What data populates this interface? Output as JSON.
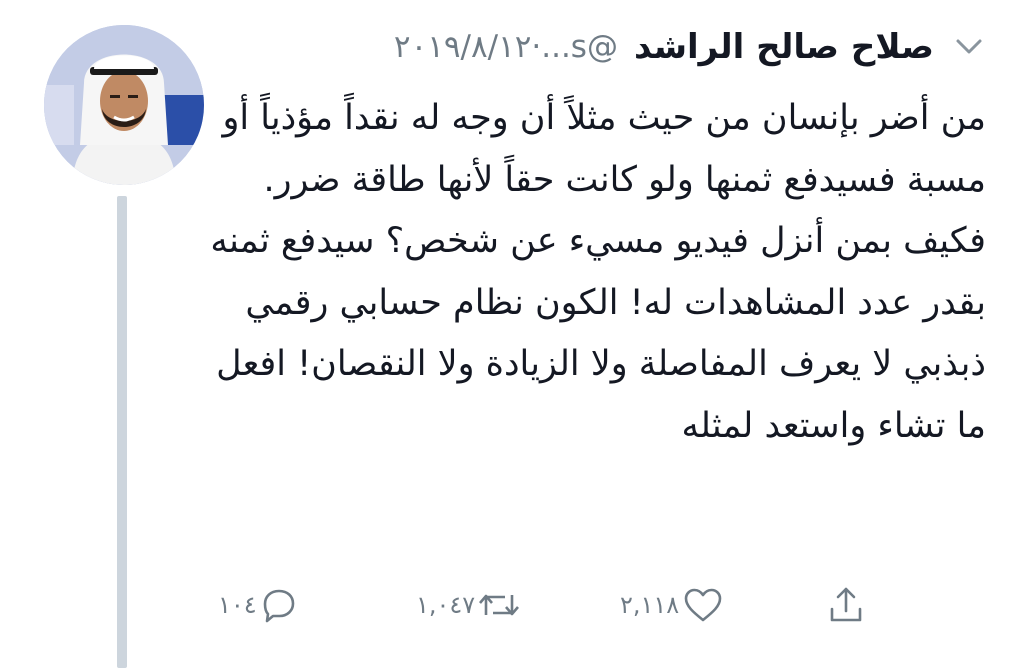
{
  "tweet": {
    "author": {
      "display_name": "صلاح صالح الراشد",
      "handle": "@s...",
      "avatar": "avatar-photo"
    },
    "timestamp_sep": "·",
    "timestamp": "٢٠١٩/٨/١٢",
    "menu_icon": "chevron-down-icon",
    "text": "من أضر بإنسان من حيث مثلاً أن وجه له نقداً مؤذياً أو مسبة فسيدفع ثمنها ولو كانت حقاً لأنها طاقة ضرر. فكيف بمن أنزل فيديو مسيء عن شخص؟ سيدفع ثمنه بقدر عدد المشاهدات له! الكون نظام حسابي رقمي ذبذبي لا يعرف المفاصلة ولا الزيادة ولا النقصان! افعل ما تشاء واستعد لمثله",
    "actions": {
      "reply": {
        "icon": "reply-icon",
        "count": "١٠٤"
      },
      "retweet": {
        "icon": "retweet-icon",
        "count": "١,٠٤٧"
      },
      "like": {
        "icon": "heart-icon",
        "count": "٢,١١٨"
      },
      "share": {
        "icon": "share-icon"
      }
    }
  },
  "colors": {
    "text": "#141823",
    "secondary": "#6f7b85",
    "thread_line": "#cdd5dd",
    "background": "#ffffff"
  }
}
